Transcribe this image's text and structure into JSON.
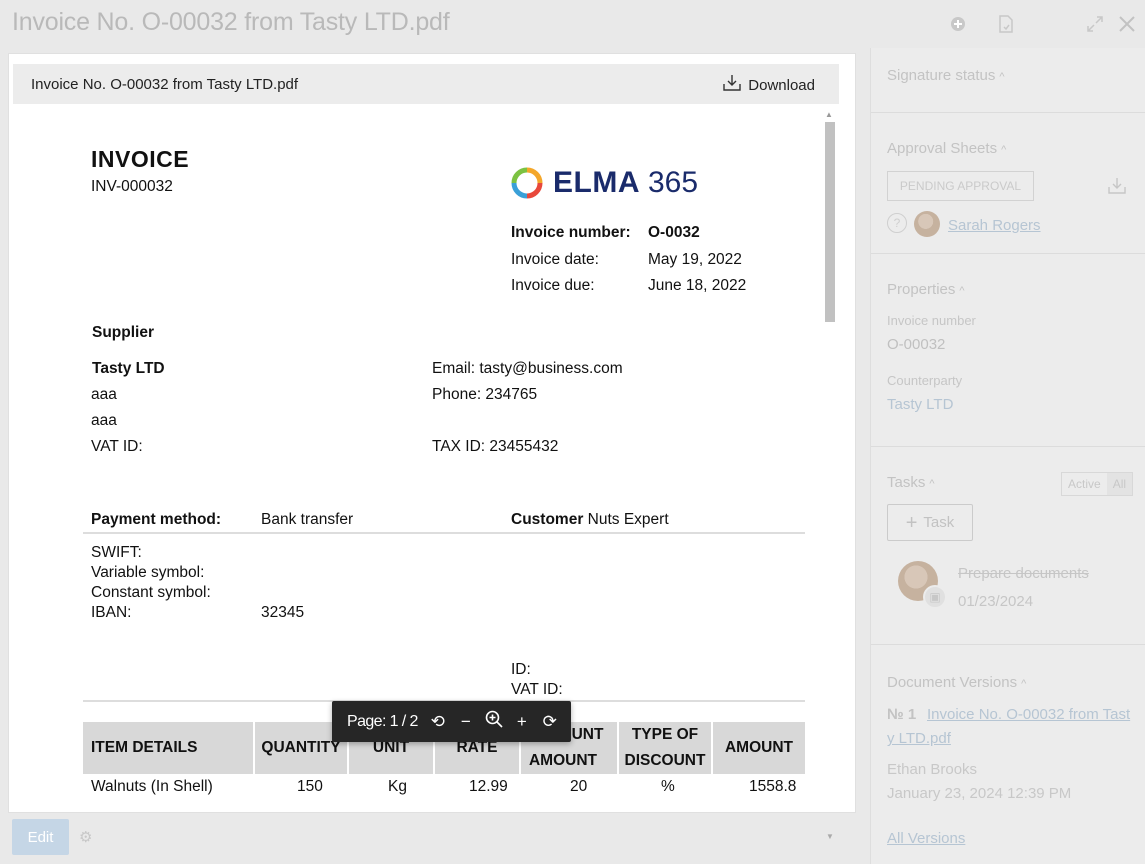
{
  "window": {
    "title": "Invoice No. O-00032 from Tasty LTD.pdf",
    "icons": [
      "plus-circle-icon",
      "document-icon",
      "expand-icon",
      "close-icon"
    ]
  },
  "viewer": {
    "file_name": "Invoice No. O-00032 from Tasty LTD.pdf",
    "download_label": "Download"
  },
  "invoice": {
    "heading": "INVOICE",
    "code": "INV-000032",
    "logo_text": "ELMA",
    "logo_num": "365",
    "meta": [
      {
        "label": "Invoice number:",
        "value": "O-0032"
      },
      {
        "label": "Invoice date:",
        "value": "May 19, 2022"
      },
      {
        "label": "Invoice due:",
        "value": "June 18, 2022"
      }
    ],
    "supplier_heading": "Supplier",
    "supplier_name": "Tasty LTD",
    "supplier_line1": "aaa",
    "supplier_line2": "aaa",
    "vat_label": "VAT ID:",
    "email": "Email: tasty@business.com",
    "phone": "Phone: 234765",
    "tax_id": "TAX ID: 23455432",
    "payment_label": "Payment method:",
    "payment_value": "Bank transfer",
    "customer_label": "Customer",
    "customer_value": "Nuts Expert",
    "swift": "SWIFT:",
    "variable_symbol": "Variable symbol:",
    "constant_symbol": "Constant symbol:",
    "iban_label": "IBAN:",
    "iban_value": "32345",
    "cust_id": "ID:",
    "cust_vat": "VAT ID:",
    "columns": [
      "ITEM DETAILS",
      "QUANTITY",
      "UNIT",
      "RATE",
      "DISCOUNT",
      "AMOUNT",
      "TYPE OF",
      "DISCOUNT",
      "AMOUNT"
    ],
    "row": [
      "Walnuts (In Shell)",
      "150",
      "Kg",
      "12.99",
      "20",
      "%",
      "1558.8"
    ]
  },
  "page_toolbar": {
    "page_text": "Page: 1 / 2",
    "rotate": "⟲",
    "zoom_out": "−",
    "zoom_icon": "⊕",
    "zoom_in": "+",
    "rotate_cw": "⟳"
  },
  "bottom": {
    "edit_label": "Edit"
  },
  "side_panel": {
    "signature_status": "Signature status",
    "approval_sheets": "Approval Sheets",
    "pending_approval": "PENDING APPROVAL",
    "approver": "Sarah Rogers",
    "help": "?",
    "properties": "Properties",
    "invoice_number_label": "Invoice number",
    "invoice_number_value": "O-00032",
    "counterparty_label": "Counterparty",
    "counterparty_value": "Tasty LTD",
    "tasks": "Tasks",
    "active": "Active",
    "all": "All",
    "add_task": "Task",
    "task_title": "Prepare documents",
    "task_date": "01/23/2024",
    "document_versions": "Document Versions",
    "version_no": "№ 1",
    "version_file_1": "Invoice No. O-00032 from Tast",
    "version_file_2": "y LTD.pdf",
    "version_author": "Ethan Brooks",
    "version_date": "January 23, 2024 12:39 PM",
    "all_versions": "All Versions",
    "caret": "^"
  },
  "colors": {
    "accent_link": "#b6c5d3",
    "logo_blue": "#1a2b6b",
    "edit_button": "#c5d6e6",
    "toolbar_bg": "#262626"
  }
}
